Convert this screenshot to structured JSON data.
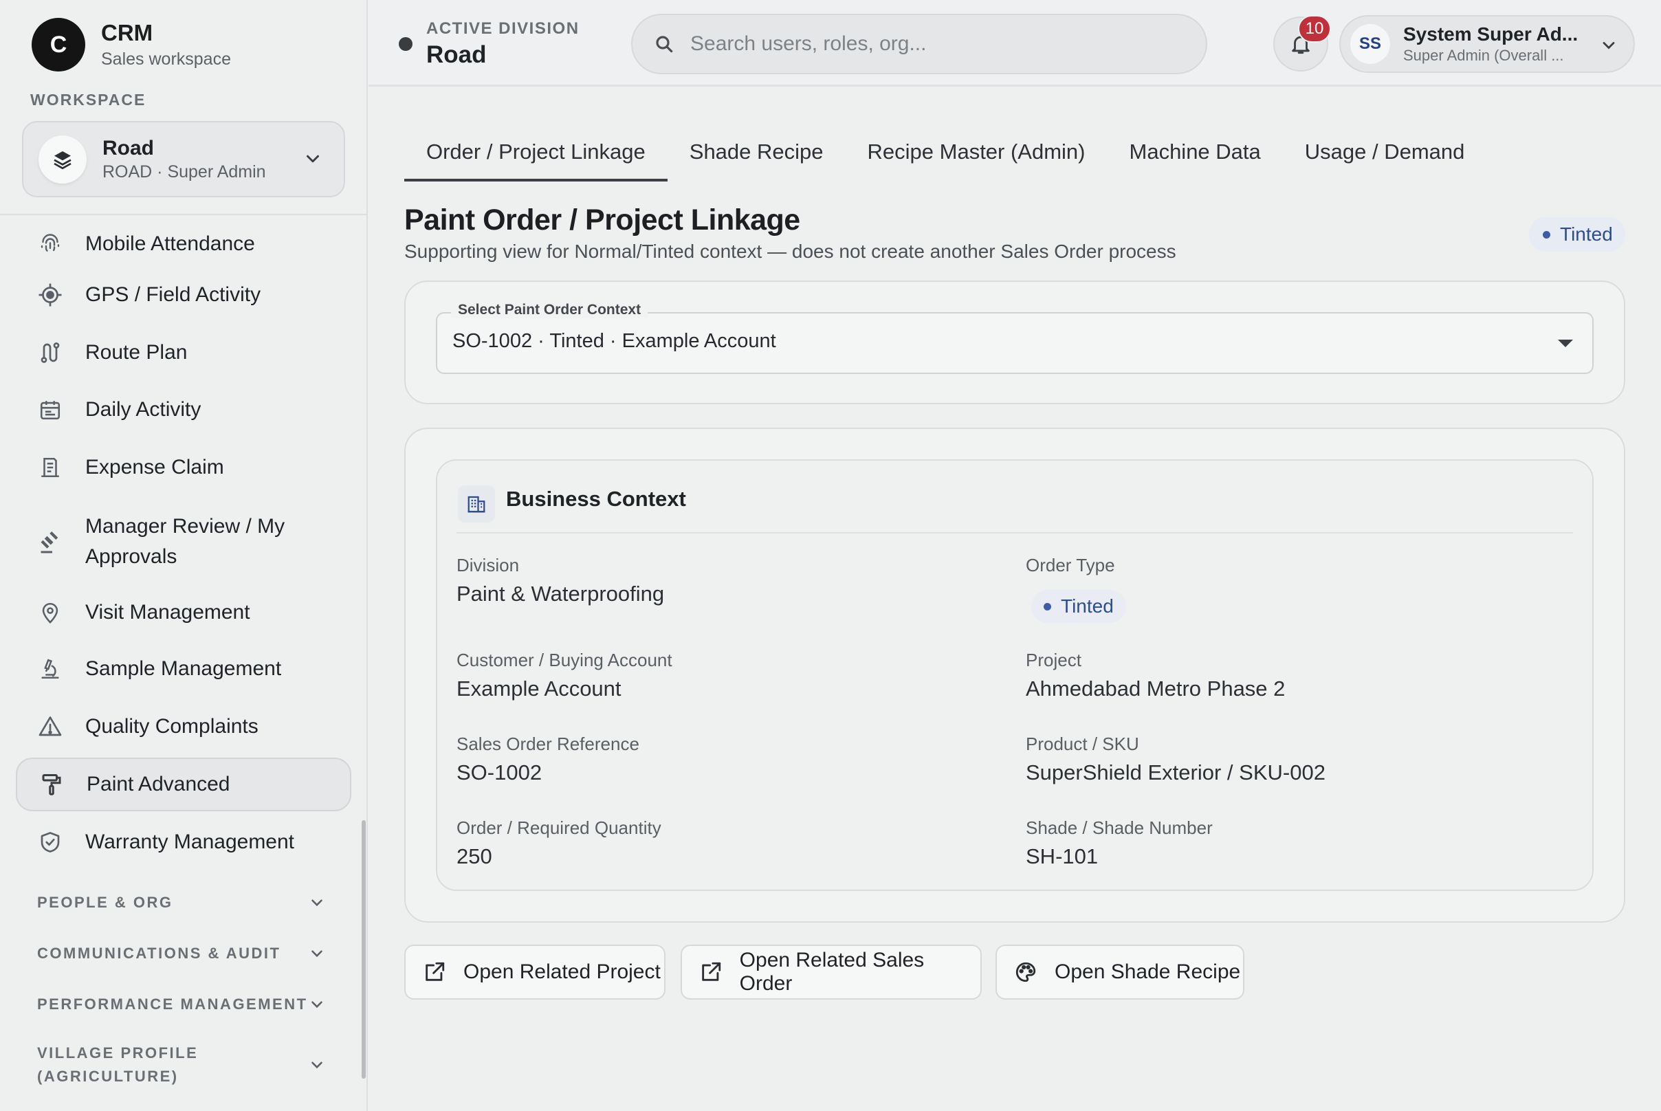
{
  "app": {
    "title": "CRM",
    "subtitle": "Sales workspace",
    "logo_letter": "C"
  },
  "workspace": {
    "section_label": "WORKSPACE",
    "name": "Road",
    "role": "ROAD · Super Admin"
  },
  "sidebar": {
    "items": [
      {
        "label": "Mobile Attendance",
        "icon": "fingerprint-icon"
      },
      {
        "label": "GPS / Field Activity",
        "icon": "gps-target-icon"
      },
      {
        "label": "Route Plan",
        "icon": "route-icon"
      },
      {
        "label": "Daily Activity",
        "icon": "calendar-icon"
      },
      {
        "label": "Expense Claim",
        "icon": "receipt-icon"
      },
      {
        "label": "Manager Review / My Approvals",
        "icon": "gavel-icon"
      },
      {
        "label": "Visit Management",
        "icon": "location-pin-icon"
      },
      {
        "label": "Sample Management",
        "icon": "microscope-icon"
      },
      {
        "label": "Quality Complaints",
        "icon": "warning-icon"
      },
      {
        "label": "Paint Advanced",
        "icon": "paint-roller-icon",
        "active": true
      },
      {
        "label": "Warranty Management",
        "icon": "shield-check-icon"
      }
    ],
    "sections": [
      {
        "label": "PEOPLE & ORG"
      },
      {
        "label": "COMMUNICATIONS & AUDIT"
      },
      {
        "label": "PERFORMANCE MANAGEMENT"
      },
      {
        "label": "VILLAGE PROFILE (AGRICULTURE)"
      }
    ]
  },
  "topbar": {
    "division_label": "ACTIVE DIVISION",
    "division_name": "Road",
    "search_placeholder": "Search users, roles, org...",
    "notification_count": "10",
    "user": {
      "initials": "SS",
      "name": "System Super Ad...",
      "role": "Super Admin (Overall ..."
    }
  },
  "tabs": [
    {
      "label": "Order / Project Linkage",
      "active": true
    },
    {
      "label": "Shade Recipe"
    },
    {
      "label": "Recipe Master (Admin)"
    },
    {
      "label": "Machine Data"
    },
    {
      "label": "Usage / Demand"
    }
  ],
  "page": {
    "title": "Paint Order / Project Linkage",
    "subtitle": "Supporting view for Normal/Tinted context — does not create another Sales Order process",
    "status_badge": "Tinted"
  },
  "order_select": {
    "label": "Select Paint Order Context",
    "value": "SO-1002 · Tinted · Example Account"
  },
  "business_context": {
    "title": "Business Context",
    "fields": {
      "division": {
        "label": "Division",
        "value": "Paint & Waterproofing"
      },
      "order_type": {
        "label": "Order Type",
        "value": "Tinted"
      },
      "customer": {
        "label": "Customer / Buying Account",
        "value": "Example Account"
      },
      "project": {
        "label": "Project",
        "value": "Ahmedabad Metro Phase 2"
      },
      "sales_order": {
        "label": "Sales Order Reference",
        "value": "SO-1002"
      },
      "product": {
        "label": "Product / SKU",
        "value": "SuperShield Exterior / SKU-002"
      },
      "quantity": {
        "label": "Order / Required Quantity",
        "value": "250"
      },
      "shade": {
        "label": "Shade / Shade Number",
        "value": "SH-101"
      }
    }
  },
  "actions": {
    "open_project": "Open Related Project",
    "open_sales_order": "Open Related Sales Order",
    "open_shade_recipe": "Open Shade Recipe"
  },
  "colors": {
    "accent_blue": "#2d4d8e",
    "badge_red": "#c0303a",
    "logo_bg": "#141414"
  }
}
